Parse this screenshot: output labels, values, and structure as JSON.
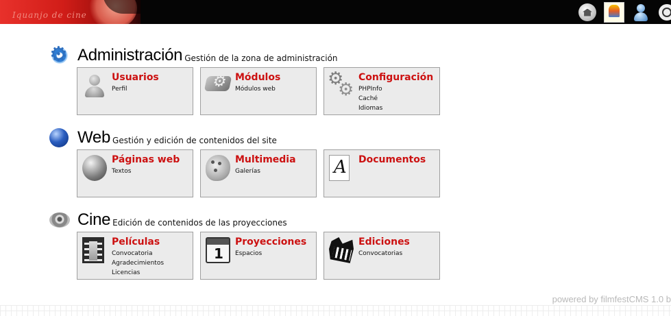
{
  "header": {
    "banner_text": "Iquanjo de cine",
    "icons": [
      "home-icon",
      "festival-logo-icon",
      "user-icon",
      "power-icon"
    ]
  },
  "sections": [
    {
      "title": "Administración",
      "subtitle": "Gestión de la zona de administración",
      "icon": "gears-icon",
      "cards": [
        {
          "title": "Usuarios",
          "links": [
            "Perfil"
          ],
          "icon": "user-icon"
        },
        {
          "title": "Módulos",
          "links": [
            "Módulos web"
          ],
          "icon": "modules-icon"
        },
        {
          "title": "Configuración",
          "links": [
            "PHPInfo",
            "Caché",
            "Idiomas"
          ],
          "icon": "settings-icon"
        }
      ]
    },
    {
      "title": "Web",
      "subtitle": "Gestión y edición de contenidos del site",
      "icon": "globe-icon",
      "cards": [
        {
          "title": "Páginas web",
          "links": [
            "Textos"
          ],
          "icon": "web-pages-icon"
        },
        {
          "title": "Multimedia",
          "links": [
            "Galerías"
          ],
          "icon": "palette-icon"
        },
        {
          "title": "Documentos",
          "links": [],
          "icon": "document-icon"
        }
      ]
    },
    {
      "title": "Cine",
      "subtitle": "Edición de contenidos de las proyecciones",
      "icon": "film-reel-icon",
      "cards": [
        {
          "title": "Películas",
          "links": [
            "Convocatoria",
            "Agradecimientos",
            "Licencias"
          ],
          "icon": "film-strip-icon"
        },
        {
          "title": "Proyecciones",
          "links": [
            "Espacios"
          ],
          "icon": "calendar-icon"
        },
        {
          "title": "Ediciones",
          "links": [
            "Convocatorias"
          ],
          "icon": "editions-icon"
        }
      ]
    }
  ],
  "footer": {
    "text": "powered by filmfestCMS 1.0 b"
  }
}
